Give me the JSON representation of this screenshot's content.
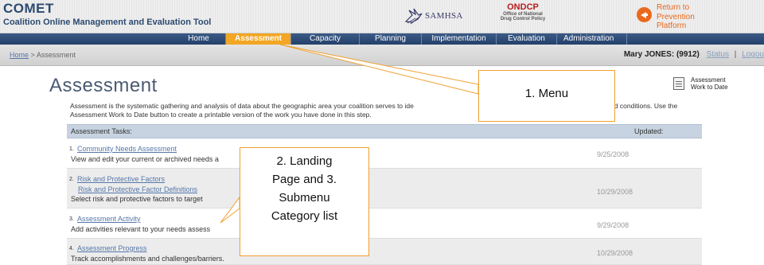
{
  "header": {
    "app_title": "COMET",
    "app_subtitle": "Coalition Online Management and Evaluation Tool",
    "samhsa_logo_text": "SAMHSA",
    "ondcp_title": "ONDCP",
    "ondcp_sub": [
      "Office of National",
      "Drug Control Policy"
    ],
    "return_label": "Return to Prevention Platform"
  },
  "nav": {
    "items": [
      "Home",
      "Assessment",
      "Capacity",
      "Planning",
      "Implementation",
      "Evaluation",
      "Administration"
    ],
    "active": "Assessment"
  },
  "breadcrumb": {
    "home": "Home",
    "separator": ">",
    "current": "Assessment"
  },
  "user": {
    "name": "Mary JONES: (9912)",
    "status_link": "Status",
    "separator": "|",
    "logout_link": "Logou"
  },
  "page": {
    "title": "Assessment",
    "work_to_date_label": "Assessment Work to Date",
    "intro_line1": "Assessment is the systematic gathering and analysis of data about the geographic area your coalition serves to ide",
    "intro_line1_end": "ated conditions. Use the",
    "intro_line2": "Assessment Work to Date button to create a printable version of the work you have done in this step."
  },
  "tasks": {
    "header_tasks": "Assessment Tasks:",
    "header_updated": "Updated:",
    "items": [
      {
        "num": "1.",
        "links": [
          "Community Needs Assessment"
        ],
        "desc": "View and edit your current or archived needs a",
        "date": "9/25/2008"
      },
      {
        "num": "2.",
        "links": [
          "Risk and Protective Factors",
          "Risk and Protective Factor Definitions"
        ],
        "desc": "Select risk and protective factors to target",
        "date": "10/29/2008"
      },
      {
        "num": "3.",
        "links": [
          "Assessment Activity"
        ],
        "desc": "Add activities relevant to your needs assess",
        "date": "9/29/2008"
      },
      {
        "num": "4.",
        "links": [
          "Assessment Progress"
        ],
        "desc": "Track accomplishments and challenges/barriers.",
        "date": "10/29/2008"
      }
    ]
  },
  "callouts": {
    "menu": "1. Menu",
    "landing_lines": [
      "2. Landing",
      "Page and 3.",
      "Submenu",
      "Category list"
    ]
  },
  "colors": {
    "nav_bg": "#2f4f7a",
    "nav_active": "#f2a623",
    "callout_border": "#f0a030",
    "brand_orange": "#e9691e",
    "link_blue": "#5577aa"
  }
}
